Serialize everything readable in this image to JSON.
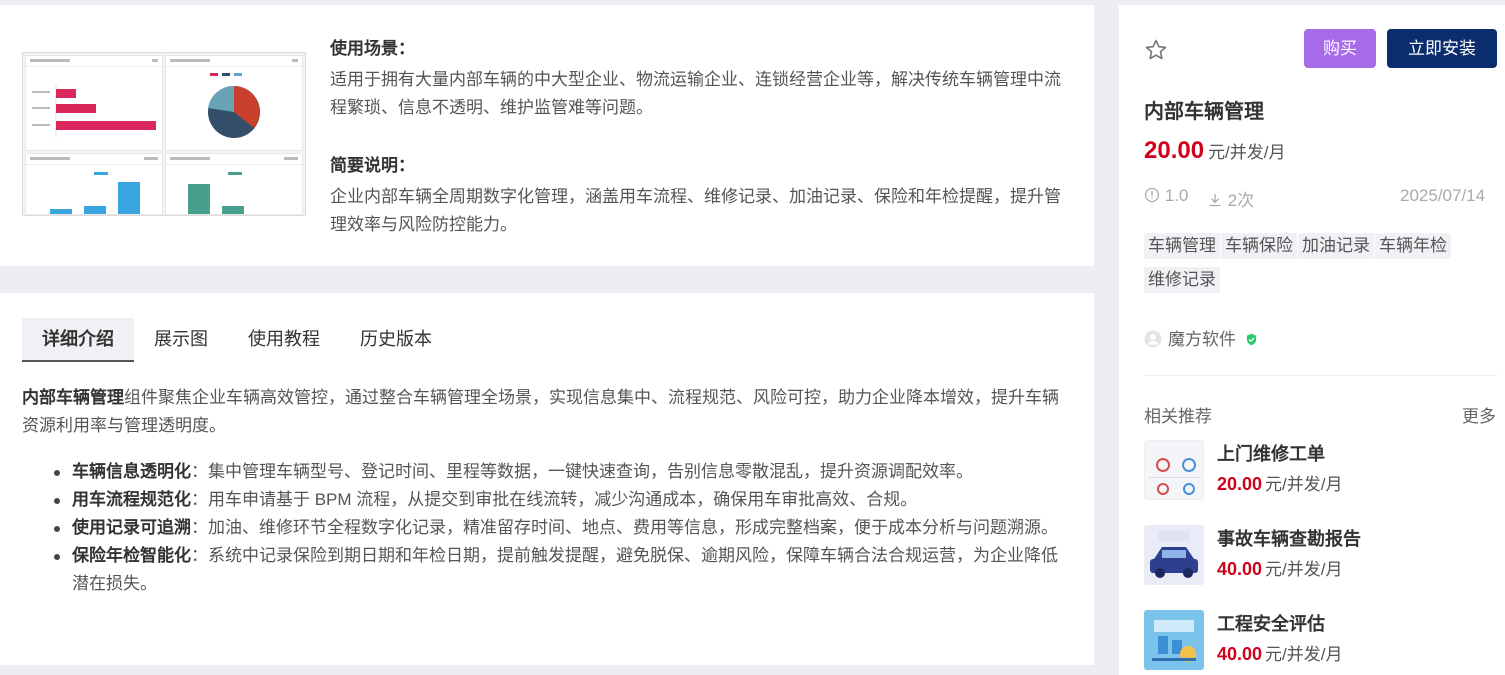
{
  "overview": {
    "scenario_title": "使用场景：",
    "scenario_text": "适用于拥有大量内部车辆的中大型企业、物流运输企业、连锁经营企业等，解决传统车辆管理中流程繁琐、信息不透明、维护监管难等问题。",
    "summary_title": "简要说明：",
    "summary_text": "企业内部车辆全周期数字化管理，涵盖用车流程、维修记录、加油记录、保险和年检提醒，提升管理效率与风险防控能力。"
  },
  "tabs": [
    {
      "label": "详细介绍",
      "active": true
    },
    {
      "label": "展示图",
      "active": false
    },
    {
      "label": "使用教程",
      "active": false
    },
    {
      "label": "历史版本",
      "active": false
    }
  ],
  "detail": {
    "intro_bold": "内部车辆管理",
    "intro_text": "组件聚焦企业车辆高效管控，通过整合车辆管理全场景，实现信息集中、流程规范、风险可控，助力企业降本增效，提升车辆资源利用率与管理透明度。",
    "features": [
      {
        "title": "车辆信息透明化",
        "text": "：集中管理车辆型号、登记时间、里程等数据，一键快速查询，告别信息零散混乱，提升资源调配效率。"
      },
      {
        "title": "用车流程规范化",
        "text": "：用车申请基于 BPM 流程，从提交到审批在线流转，减少沟通成本，确保用车审批高效、合规。"
      },
      {
        "title": "使用记录可追溯",
        "text": "：加油、维修环节全程数字化记录，精准留存时间、地点、费用等信息，形成完整档案，便于成本分析与问题溯源。"
      },
      {
        "title": "保险年检智能化",
        "text": "：系统中记录保险到期日期和年检日期，提前触发提醒，避免脱保、逾期风险，保障车辆合法合规运营，为企业降低潜在损失。"
      }
    ]
  },
  "product": {
    "buy_label": "购买",
    "install_label": "立即安装",
    "title": "内部车辆管理",
    "price": "20.00",
    "price_unit": "元/并发/月",
    "version": "1.0",
    "downloads": "2次",
    "date": "2025/07/14",
    "tags": [
      "车辆管理",
      "车辆保险",
      "加油记录",
      "车辆年检",
      "维修记录"
    ],
    "author": "魔方软件",
    "colors": {
      "buy": "#a86bea",
      "install": "#0b2d6e",
      "price": "#d0021b",
      "verified": "#2ecc71"
    }
  },
  "recommend": {
    "title": "相关推荐",
    "more": "更多",
    "items": [
      {
        "name": "上门维修工单",
        "price": "20.00",
        "unit": "元/并发/月"
      },
      {
        "name": "事故车辆查勘报告",
        "price": "40.00",
        "unit": "元/并发/月"
      },
      {
        "name": "工程安全评估",
        "price": "40.00",
        "unit": "元/并发/月"
      }
    ]
  }
}
